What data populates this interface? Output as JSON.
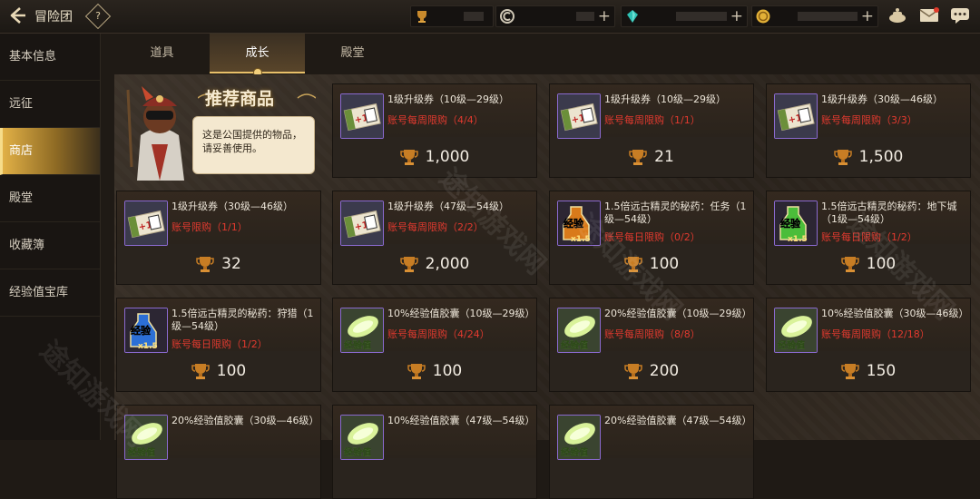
{
  "header": {
    "title": "冒险团",
    "help": "?",
    "resources": [
      {
        "icon": "trophy-icon",
        "color": "#c98a2c"
      },
      {
        "icon": "coin-c-icon",
        "color": "#cfc7b5"
      },
      {
        "icon": "gem-icon",
        "color": "#2ec0b3"
      },
      {
        "icon": "gold-coin-icon",
        "color": "#e2b037"
      }
    ],
    "plus": "+"
  },
  "sidebar": {
    "items": [
      {
        "label": "基本信息"
      },
      {
        "label": "远征"
      },
      {
        "label": "商店"
      },
      {
        "label": "殿堂"
      },
      {
        "label": "收藏簿"
      },
      {
        "label": "经验值宝库"
      }
    ],
    "active": 2
  },
  "tabs": [
    {
      "label": "道具"
    },
    {
      "label": "成长"
    },
    {
      "label": "殿堂"
    }
  ],
  "recommend": {
    "title": "推荐商品",
    "text_line1": "这是公国提供的物品，",
    "text_line2": "请妥善使用。"
  },
  "cards": [
    {
      "name": "1级升级券（10级—29级）",
      "limit": "账号每周限购（4/4）",
      "price": "1,000",
      "kind": "ticket"
    },
    {
      "name": "1级升级券（10级—29级）",
      "limit": "账号每周限购（1/1）",
      "price": "21",
      "kind": "ticket"
    },
    {
      "name": "1级升级券（30级—46级）",
      "limit": "账号每周限购（3/3）",
      "price": "1,500",
      "kind": "ticket"
    },
    {
      "name": "1级升级券（30级—46级）",
      "limit": "账号限购（1/1）",
      "price": "32",
      "kind": "ticket"
    },
    {
      "name": "1级升级券（47级—54级）",
      "limit": "账号每周限购（2/2）",
      "price": "2,000",
      "kind": "ticket"
    },
    {
      "name": "1.5倍远古精灵的秘药：任务（1级—54级）",
      "limit": "账号每日限购（0/2）",
      "price": "100",
      "kind": "potion-orange",
      "badge": "经验",
      "mult": "x1.5"
    },
    {
      "name": "1.5倍远古精灵的秘药：地下城（1级—54级）",
      "limit": "账号每日限购（1/2）",
      "price": "100",
      "kind": "potion-green",
      "badge": "经验",
      "mult": "x1.5"
    },
    {
      "name": "1.5倍远古精灵的秘药：狩猎（1级—54级）",
      "limit": "账号每日限购（1/2）",
      "price": "100",
      "kind": "potion-blue",
      "badge": "经验",
      "mult": "x1.5"
    },
    {
      "name": "10%经验值胶囊（10级—29级）",
      "limit": "账号每周限购（4/24）",
      "price": "100",
      "kind": "capsule",
      "badge": "经验值"
    },
    {
      "name": "20%经验值胶囊（10级—29级）",
      "limit": "账号每周限购（8/8）",
      "price": "200",
      "kind": "capsule",
      "badge": "经验值"
    },
    {
      "name": "10%经验值胶囊（30级—46级）",
      "limit": "账号每周限购（12/18）",
      "price": "150",
      "kind": "capsule",
      "badge": "经验值"
    },
    {
      "name": "20%经验值胶囊（30级—46级）",
      "limit": "",
      "price": "",
      "kind": "capsule",
      "badge": "经验值"
    },
    {
      "name": "10%经验值胶囊（47级—54级）",
      "limit": "",
      "price": "",
      "kind": "capsule",
      "badge": "经验值"
    },
    {
      "name": "20%经验值胶囊（47级—54级）",
      "limit": "",
      "price": "",
      "kind": "capsule",
      "badge": "经验值"
    }
  ],
  "watermark": "途知游戏网",
  "colors": {
    "limit_red": "#e23a2f",
    "accent_gold": "#e8c06a",
    "active_tab": "#e1b046"
  }
}
